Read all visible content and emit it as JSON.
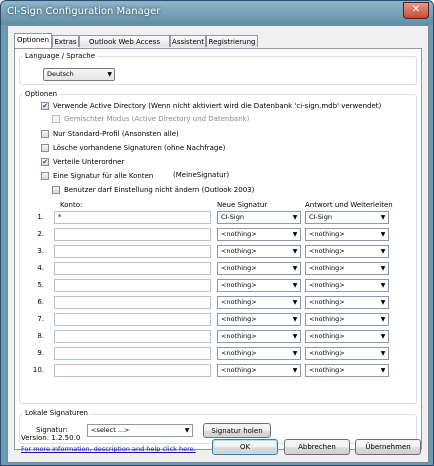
{
  "window": {
    "title": "CI-Sign Configuration Manager",
    "close_glyph": "✕"
  },
  "tabs": [
    {
      "label": "Optionen"
    },
    {
      "label": "Extras"
    },
    {
      "label": "Outlook Web Access (OWA)"
    },
    {
      "label": "Assistent"
    },
    {
      "label": "Registrierung"
    }
  ],
  "language": {
    "group_label": "Language / Sprache",
    "selected": "Deutsch"
  },
  "options": {
    "group_label": "Optionen",
    "checkboxes": [
      {
        "label": "Verwende Active Directory (Wenn nicht aktiviert wird die Datenbank 'ci-sign.mdb' verwendet)",
        "checked": true,
        "disabled": false
      },
      {
        "label": "Gemischter Modus (Active Directory und Datenbank)",
        "checked": false,
        "disabled": true
      },
      {
        "label": "Nur Standard-Profil (Ansonsten alle)",
        "checked": false,
        "disabled": false
      },
      {
        "label": "Lösche vorhandene Signaturen (ohne Nachfrage)",
        "checked": false,
        "disabled": false
      },
      {
        "label": "Verteile Unterordner",
        "checked": true,
        "disabled": false
      },
      {
        "label": "Eine Signatur für alle Konten",
        "checked": false,
        "disabled": false,
        "extra": "(MeineSignatur)"
      },
      {
        "label": "Benutzer darf Einstellung nicht ändern (Outlook 2003)",
        "checked": false,
        "disabled": false
      }
    ],
    "headers": {
      "konto": "Konto:",
      "neue": "Neue Signatur",
      "antwort": "Antwort und Weiterleiten"
    },
    "rows": [
      {
        "num": "1.",
        "konto": "*",
        "neue": "CI-Sign",
        "antwort": "CI-Sign"
      },
      {
        "num": "2.",
        "konto": "",
        "neue": "<nothing>",
        "antwort": "<nothing>"
      },
      {
        "num": "3.",
        "konto": "",
        "neue": "<nothing>",
        "antwort": "<nothing>"
      },
      {
        "num": "4.",
        "konto": "",
        "neue": "<nothing>",
        "antwort": "<nothing>"
      },
      {
        "num": "5.",
        "konto": "",
        "neue": "<nothing>",
        "antwort": "<nothing>"
      },
      {
        "num": "6.",
        "konto": "",
        "neue": "<nothing>",
        "antwort": "<nothing>"
      },
      {
        "num": "7.",
        "konto": "",
        "neue": "<nothing>",
        "antwort": "<nothing>"
      },
      {
        "num": "8.",
        "konto": "",
        "neue": "<nothing>",
        "antwort": "<nothing>"
      },
      {
        "num": "9.",
        "konto": "",
        "neue": "<nothing>",
        "antwort": "<nothing>"
      },
      {
        "num": "10.",
        "konto": "",
        "neue": "<nothing>",
        "antwort": "<nothing>"
      }
    ]
  },
  "local_signatures": {
    "group_label": "Lokale Signaturen",
    "signatur_label": "Signatur:",
    "select_value": "<select ...>",
    "fetch_button": "Signatur holen"
  },
  "footer": {
    "version": "Version: 1.2.50.0",
    "info_link": "For more information, description and help click here.",
    "ok": "OK",
    "cancel": "Abbrechen",
    "apply": "Übernehmen"
  },
  "icons": {
    "dropdown": "▼",
    "check": "✔"
  }
}
